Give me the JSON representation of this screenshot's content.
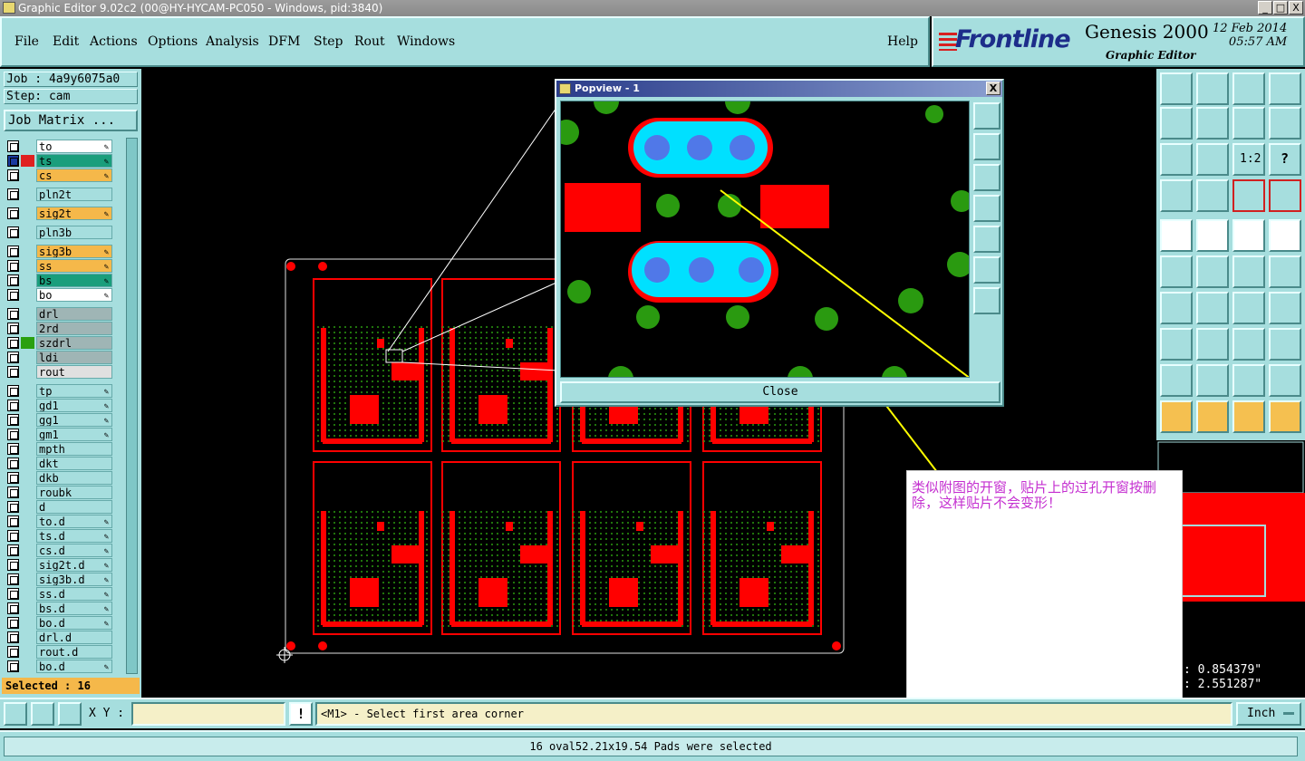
{
  "window": {
    "title": "Graphic Editor 9.02c2 (00@HY-HYCAM-PC050 - Windows, pid:3840)",
    "minimize": "_",
    "maximize": "□",
    "close": "X"
  },
  "menu": [
    "File",
    "Edit",
    "Actions",
    "Options",
    "Analysis",
    "DFM",
    "Step",
    "Rout",
    "Windows",
    "Help"
  ],
  "brand": {
    "logo": "Frontline",
    "product": "Genesis 2000",
    "subtitle": "Graphic Editor",
    "date": "12 Feb 2014",
    "time": "05:57 AM"
  },
  "left": {
    "job": "Job : 4a9y6075a0",
    "step": "Step: cam",
    "job_matrix": "Job Matrix ...",
    "selected": "Selected : 16",
    "layers": [
      {
        "name": "to",
        "color": "#ffffff",
        "edit": true
      },
      {
        "name": "ts",
        "color": "#1a9e7c",
        "edit": true,
        "active": true
      },
      {
        "name": "cs",
        "color": "#f5b84a",
        "edit": true
      },
      {
        "name": "pln2t",
        "color": "#a6dede",
        "edit": false
      },
      {
        "name": "sig2t",
        "color": "#f5b84a",
        "edit": true
      },
      {
        "name": "pln3b",
        "color": "#a6dede",
        "edit": false
      },
      {
        "name": "sig3b",
        "color": "#f5b84a",
        "edit": true
      },
      {
        "name": "ss",
        "color": "#f5b84a",
        "edit": true
      },
      {
        "name": "bs",
        "color": "#1a9e7c",
        "edit": true
      },
      {
        "name": "bo",
        "color": "#ffffff",
        "edit": true
      },
      {
        "name": "drl",
        "color": "#9fb5b5",
        "edit": false
      },
      {
        "name": "2rd",
        "color": "#9fb5b5",
        "edit": false
      },
      {
        "name": "szdrl",
        "color": "#9fb5b5",
        "edit": false,
        "marked": true
      },
      {
        "name": "ldi",
        "color": "#9fb5b5",
        "edit": false
      },
      {
        "name": "rout",
        "color": "#e0e0e0",
        "edit": false
      },
      {
        "name": "tp",
        "color": "#a6dede",
        "edit": true
      },
      {
        "name": "gd1",
        "color": "#a6dede",
        "edit": true
      },
      {
        "name": "gg1",
        "color": "#a6dede",
        "edit": true
      },
      {
        "name": "gm1",
        "color": "#a6dede",
        "edit": true
      },
      {
        "name": "mpth",
        "color": "#a6dede",
        "edit": false
      },
      {
        "name": "dkt",
        "color": "#a6dede",
        "edit": false
      },
      {
        "name": "dkb",
        "color": "#a6dede",
        "edit": false
      },
      {
        "name": "roubk",
        "color": "#a6dede",
        "edit": false
      },
      {
        "name": "d",
        "color": "#a6dede",
        "edit": false
      },
      {
        "name": "to.d",
        "color": "#a6dede",
        "edit": true
      },
      {
        "name": "ts.d",
        "color": "#a6dede",
        "edit": true
      },
      {
        "name": "cs.d",
        "color": "#a6dede",
        "edit": true
      },
      {
        "name": "sig2t.d",
        "color": "#a6dede",
        "edit": true
      },
      {
        "name": "sig3b.d",
        "color": "#a6dede",
        "edit": true
      },
      {
        "name": "ss.d",
        "color": "#a6dede",
        "edit": true
      },
      {
        "name": "bs.d",
        "color": "#a6dede",
        "edit": true
      },
      {
        "name": "bo.d",
        "color": "#a6dede",
        "edit": true
      },
      {
        "name": "drl.d",
        "color": "#a6dede",
        "edit": false
      },
      {
        "name": "rout.d",
        "color": "#a6dede",
        "edit": false
      },
      {
        "name": "bo.d",
        "color": "#a6dede",
        "edit": true
      }
    ]
  },
  "popview": {
    "title": "Popview - 1",
    "close_label": "Close",
    "close_x": "X"
  },
  "note": {
    "text": "类似附图的开窗，贴片上的过孔开窗按删除，这样贴片不会变形！"
  },
  "overview": {
    "x": ": 0.854379\"",
    "y": ": 2.551287\""
  },
  "bottom": {
    "xy_label": "X Y :",
    "xy_value": "",
    "excl": "!",
    "prompt": "<M1> - Select first area corner",
    "units": "Inch",
    "status": "16 oval52.21x19.54 Pads were selected"
  },
  "colors": {
    "panel": "#a6dede",
    "copper": "#ff0000",
    "mask": "#00e0ff",
    "via": "#2a9a10",
    "note_text": "#c42fd0",
    "selected_bg": "#f5b84a"
  }
}
